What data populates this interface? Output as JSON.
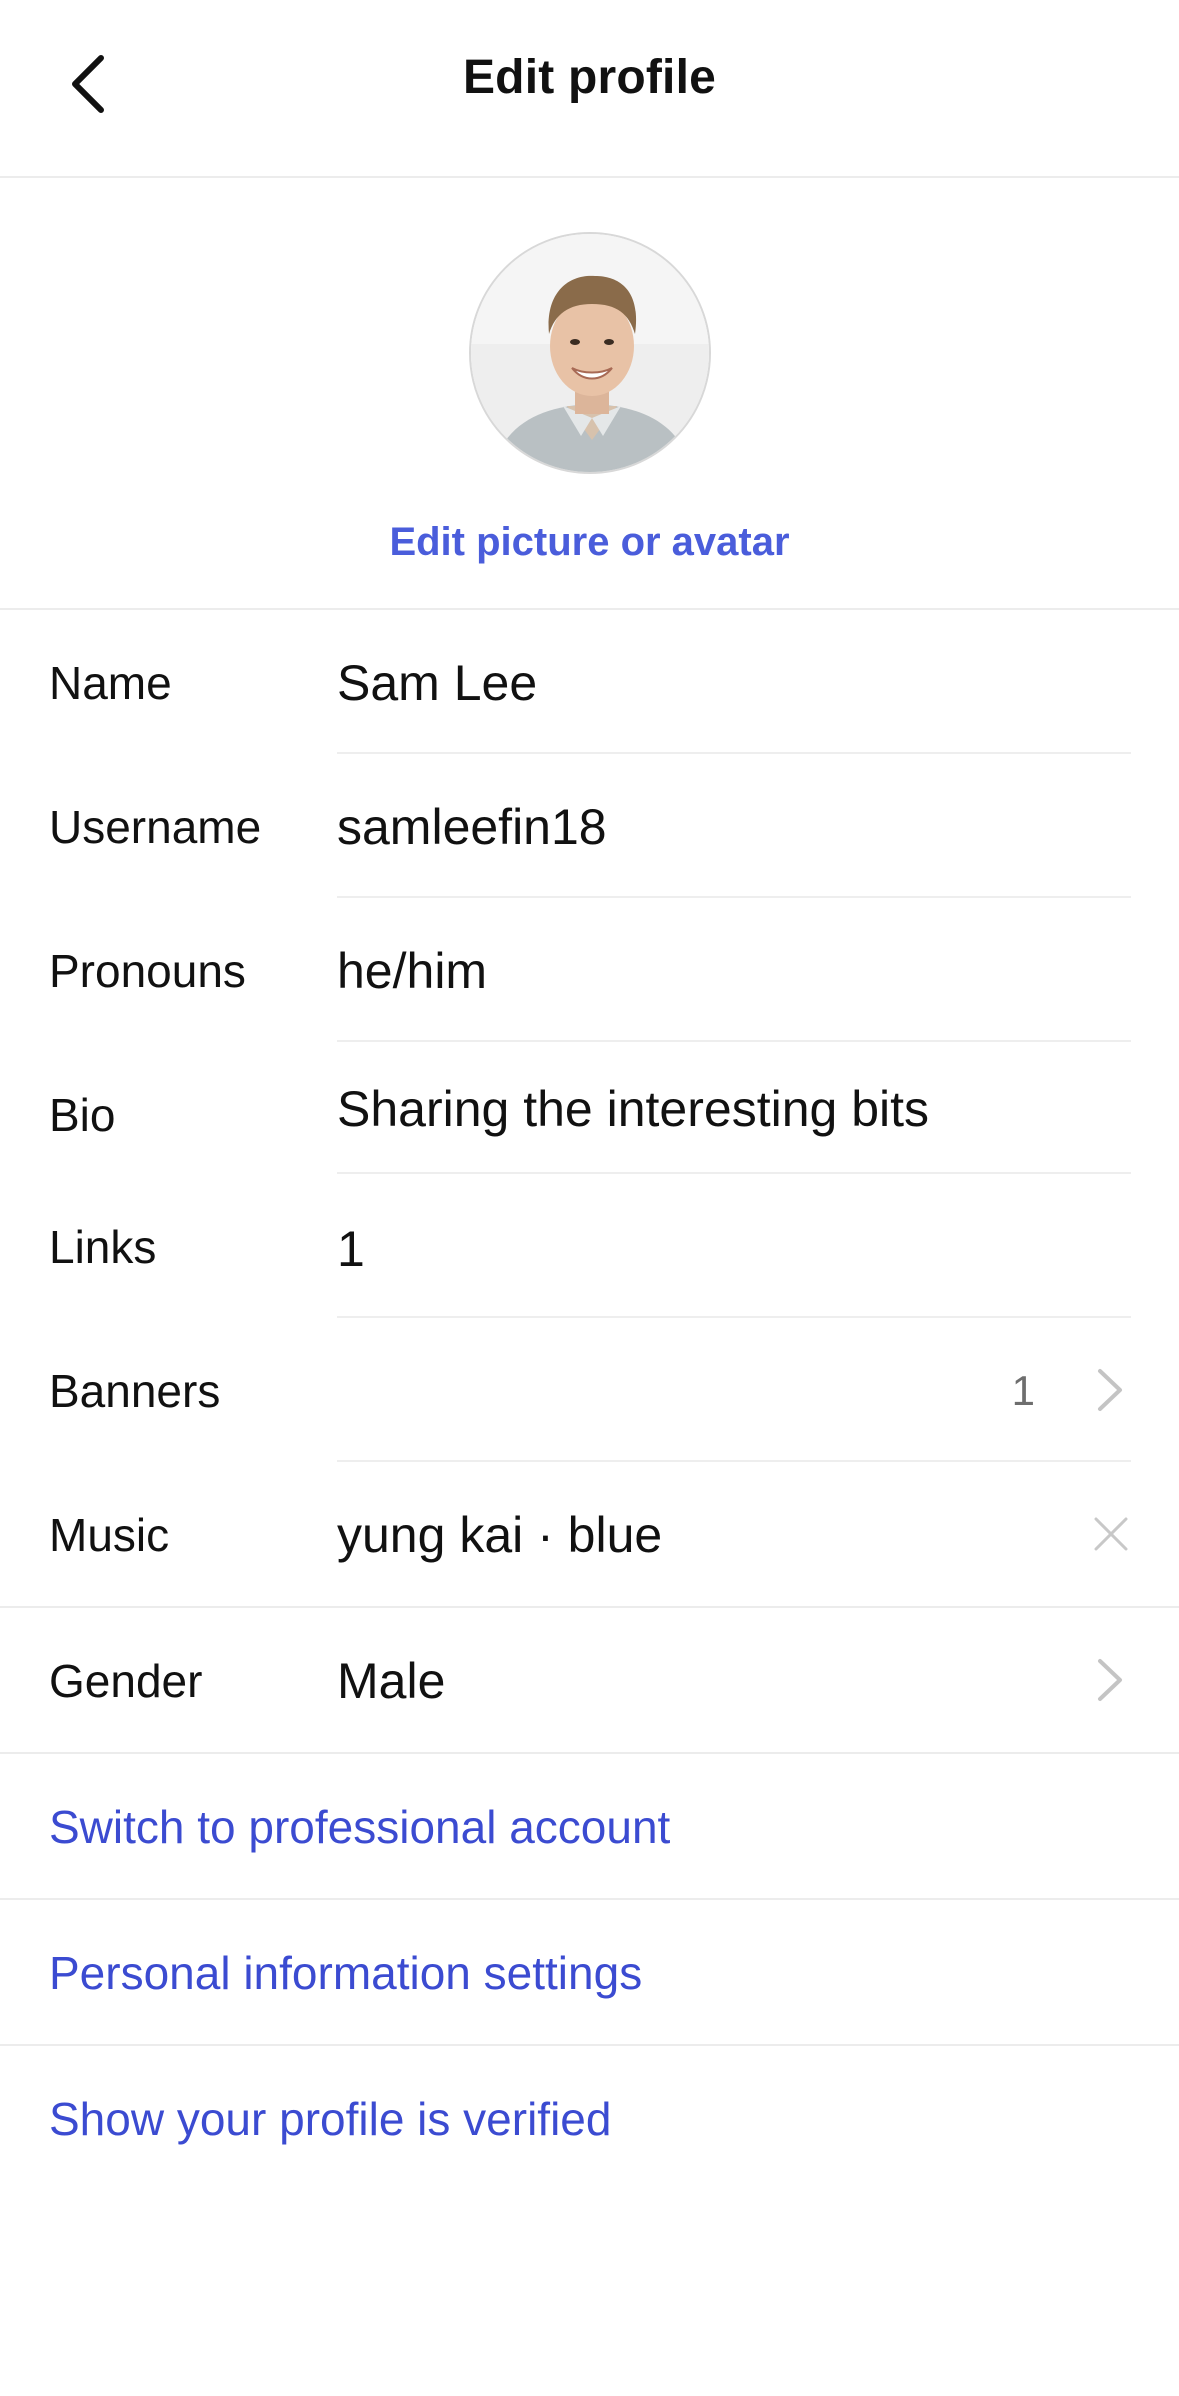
{
  "header": {
    "title": "Edit profile",
    "back_icon": "chevron-left-icon"
  },
  "avatar": {
    "edit_label": "Edit picture or avatar"
  },
  "fields": {
    "name": {
      "label": "Name",
      "value": "Sam Lee"
    },
    "username": {
      "label": "Username",
      "value": "samleefin18"
    },
    "pronouns": {
      "label": "Pronouns",
      "value": "he/him"
    },
    "bio": {
      "label": "Bio",
      "value": "Sharing the interesting bits"
    },
    "links": {
      "label": "Links",
      "value": "1"
    },
    "banners": {
      "label": "Banners",
      "count": "1"
    },
    "music": {
      "label": "Music",
      "value": "yung kai · blue"
    },
    "gender": {
      "label": "Gender",
      "value": "Male"
    }
  },
  "actions": {
    "professional": "Switch to professional account",
    "personal_info": "Personal information settings",
    "verified": "Show your profile is verified"
  },
  "colors": {
    "accent": "#4a5ddb",
    "link": "#3b4bd1",
    "separator": "#ececec"
  }
}
